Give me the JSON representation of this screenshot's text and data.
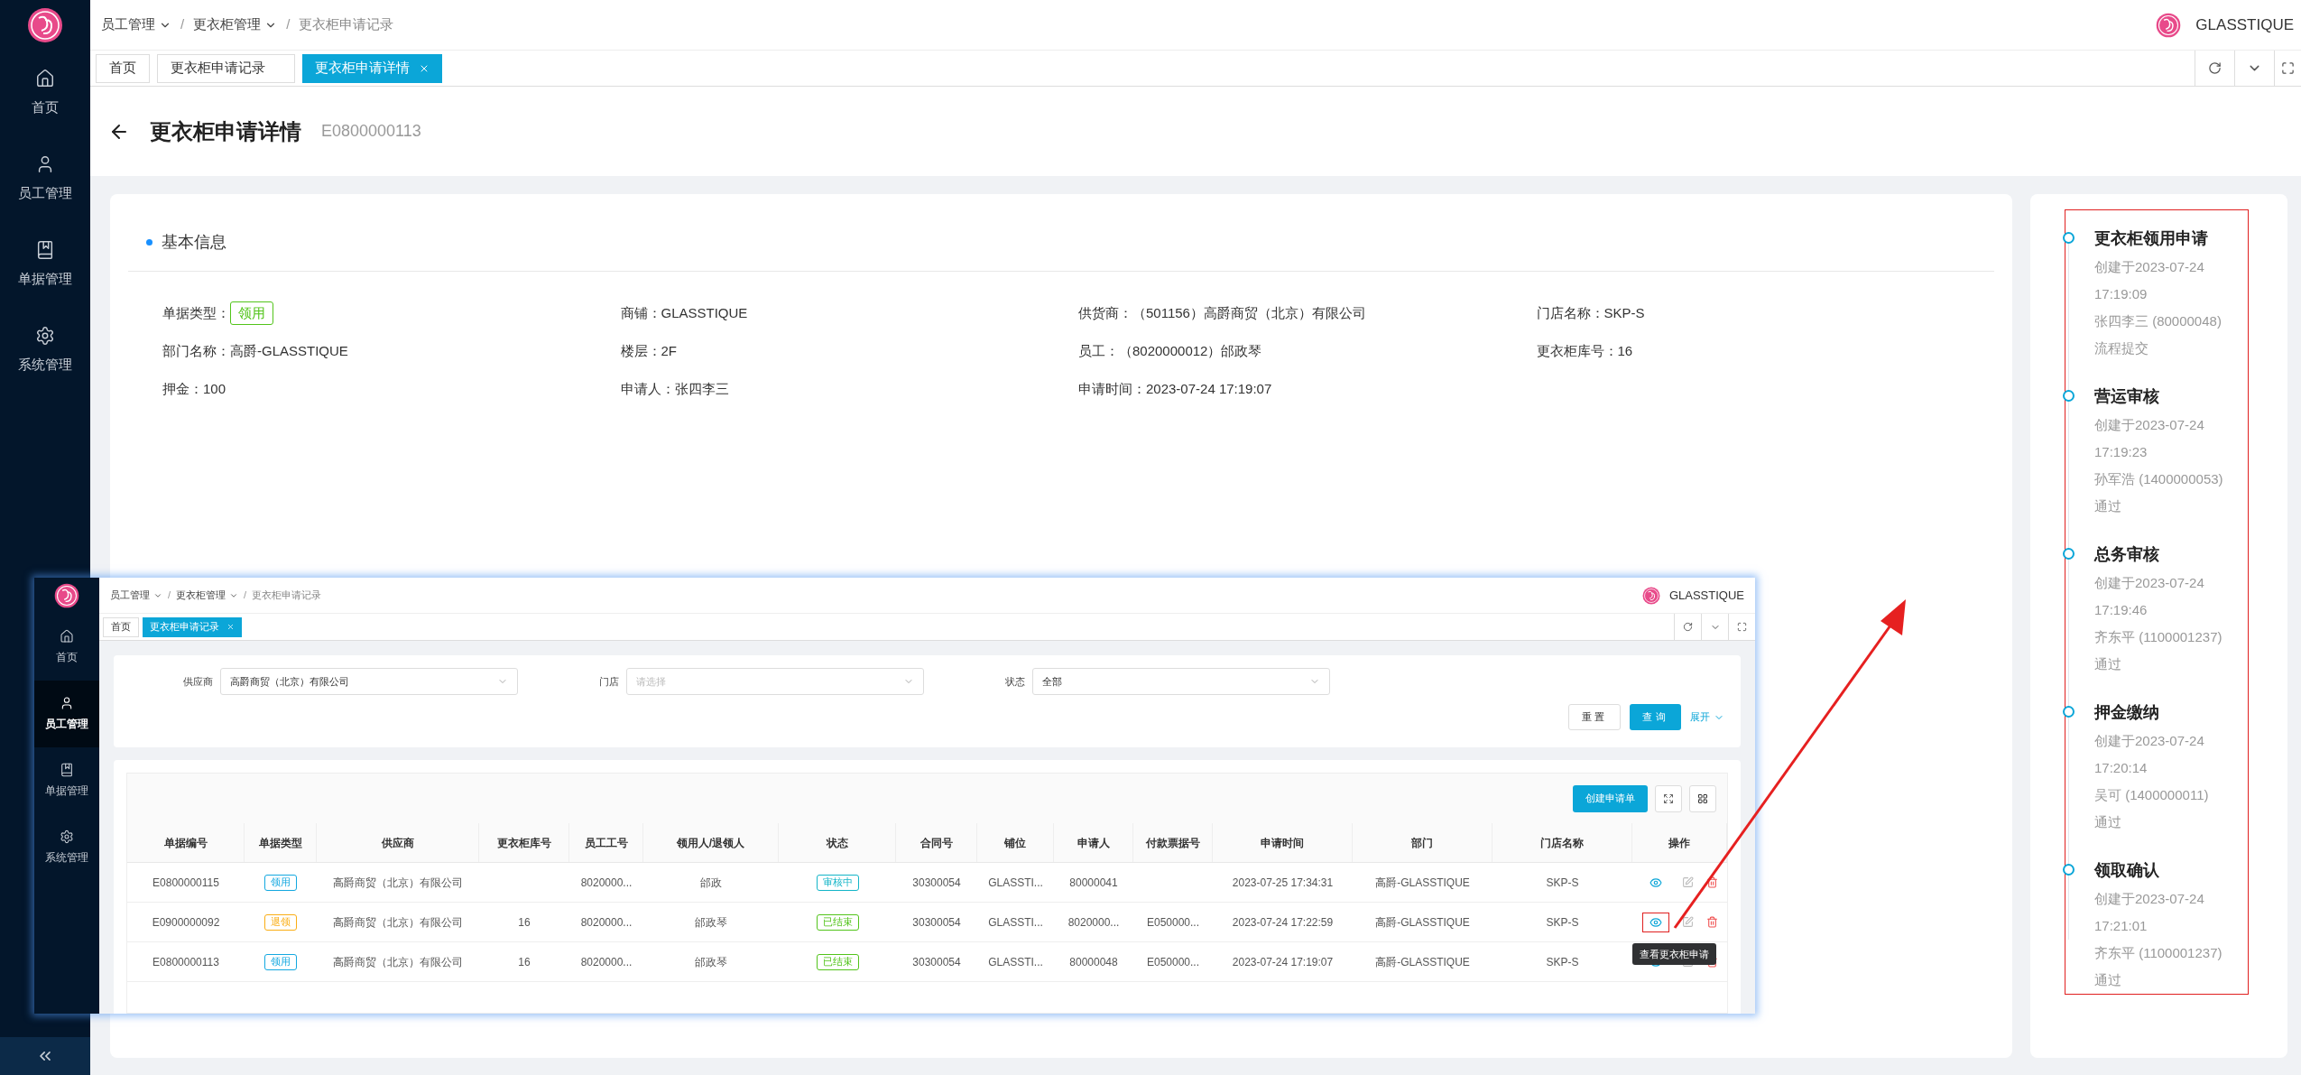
{
  "sidebar": {
    "items": [
      {
        "label": "首页",
        "selected": false
      },
      {
        "label": "员工管理",
        "selected": false
      },
      {
        "label": "单据管理",
        "selected": false
      },
      {
        "label": "系统管理",
        "selected": false
      }
    ]
  },
  "breadcrumb": {
    "separator": "/",
    "items": [
      {
        "label": "员工管理",
        "has_menu": true
      },
      {
        "label": "更衣柜管理",
        "has_menu": true
      },
      {
        "label": "更衣柜申请记录",
        "has_menu": false
      }
    ]
  },
  "brand": "GLASSTIQUE",
  "tabs": [
    {
      "label": "首页",
      "selected": false,
      "closable": false
    },
    {
      "label": "更衣柜申请记录",
      "selected": false,
      "closable": false
    },
    {
      "label": "更衣柜申请详情",
      "selected": true,
      "closable": true
    }
  ],
  "page": {
    "title": "更衣柜申请详情",
    "code": "E0800000113"
  },
  "basic_info": {
    "title": "基本信息",
    "fields": [
      {
        "label": "单据类型：",
        "value": "领用",
        "kind": "tag",
        "color": "#52c41a"
      },
      {
        "label": "商铺：",
        "value": "GLASSTIQUE",
        "kind": "text"
      },
      {
        "label": "供货商：",
        "value": "（501156）高爵商贸（北京）有限公司",
        "kind": "text"
      },
      {
        "label": "门店名称：",
        "value": "SKP-S",
        "kind": "text"
      },
      {
        "label": "部门名称：",
        "value": "高爵-GLASSTIQUE",
        "kind": "text"
      },
      {
        "label": "楼层：",
        "value": "2F",
        "kind": "text"
      },
      {
        "label": "员工：",
        "value": "（8020000012）邰政琴",
        "kind": "text"
      },
      {
        "label": "更衣柜库号：",
        "value": "16",
        "kind": "text"
      },
      {
        "label": "押金：",
        "value": "100",
        "kind": "text"
      },
      {
        "label": "申请人：",
        "value": "张四李三",
        "kind": "text"
      },
      {
        "label": "申请时间：",
        "value": "2023-07-24 17:19:07",
        "kind": "text"
      }
    ]
  },
  "timeline": [
    {
      "title": "更衣柜领用申请",
      "created": "创建于2023-07-24 17:19:09",
      "person": "张四李三 (80000048)",
      "result": "流程提交"
    },
    {
      "title": "营运审核",
      "created": "创建于2023-07-24 17:19:23",
      "person": "孙军浩 (1400000053)",
      "result": "通过"
    },
    {
      "title": "总务审核",
      "created": "创建于2023-07-24 17:19:46",
      "person": "齐东平 (1100001237)",
      "result": "通过"
    },
    {
      "title": "押金缴纳",
      "created": "创建于2023-07-24 17:20:14",
      "person": "吴可 (1400000011)",
      "result": "通过"
    },
    {
      "title": "领取确认",
      "created": "创建于2023-07-24 17:21:01",
      "person": "齐东平 (1100001237)",
      "result": "通过"
    }
  ],
  "inset": {
    "sidebar": {
      "items": [
        {
          "label": "首页",
          "selected": false
        },
        {
          "label": "员工管理",
          "selected": true
        },
        {
          "label": "单据管理",
          "selected": false
        },
        {
          "label": "系统管理",
          "selected": false
        }
      ]
    },
    "breadcrumb": {
      "separator": "/",
      "items": [
        {
          "label": "员工管理",
          "has_menu": true
        },
        {
          "label": "更衣柜管理",
          "has_menu": true
        },
        {
          "label": "更衣柜申请记录",
          "has_menu": false
        }
      ]
    },
    "brand": "GLASSTIQUE",
    "tabs": [
      {
        "label": "首页",
        "selected": false,
        "closable": false
      },
      {
        "label": "更衣柜申请记录",
        "selected": true,
        "closable": true
      }
    ],
    "filters": [
      {
        "label": "供应商",
        "value": "高爵商贸（北京）有限公司"
      },
      {
        "label": "门店",
        "placeholder": "请选择"
      },
      {
        "label": "状态",
        "value": "全部"
      }
    ],
    "reset_button": "重置",
    "query_button": "查询",
    "expand_link": "展开",
    "create_button": "创建申请单",
    "table": {
      "columns": [
        "单据编号",
        "单据类型",
        "供应商",
        "更衣柜库号",
        "员工工号",
        "领用人/退领人",
        "状态",
        "合同号",
        "铺位",
        "申请人",
        "付款票据号",
        "申请时间",
        "部门",
        "门店名称",
        "操作"
      ],
      "rows": [
        {
          "cells": [
            "E0800000115",
            {
              "label": "领用",
              "color": "#13a8e0"
            },
            "高爵商贸（北京）有限公司",
            null,
            "8020000...",
            "邰政",
            {
              "label": "审核中",
              "color": "#13b5c8"
            },
            "30300054",
            "GLASSTI...",
            "80000041",
            null,
            "2023-07-25 17:34:31",
            "高爵-GLASSTIQUE",
            "SKP-S"
          ]
        },
        {
          "cells": [
            "E0900000092",
            {
              "label": "退领",
              "color": "#faad14"
            },
            "高爵商贸（北京）有限公司",
            "16",
            "8020000...",
            "邰政琴",
            {
              "label": "已结束",
              "color": "#52c41a"
            },
            "30300054",
            "GLASSTI...",
            "8020000...",
            "E050000...",
            "2023-07-24 17:22:59",
            "高爵-GLASSTIQUE",
            "SKP-S"
          ],
          "tooltip": "查看更衣柜申请"
        },
        {
          "cells": [
            "E0800000113",
            {
              "label": "领用",
              "color": "#13a8e0"
            },
            "高爵商贸（北京）有限公司",
            "16",
            "8020000...",
            "邰政琴",
            {
              "label": "已结束",
              "color": "#52c41a"
            },
            "30300054",
            "GLASSTI...",
            "80000048",
            "E050000...",
            "2023-07-24 17:19:07",
            "高爵-GLASSTIQUE",
            "SKP-S"
          ]
        }
      ]
    }
  }
}
